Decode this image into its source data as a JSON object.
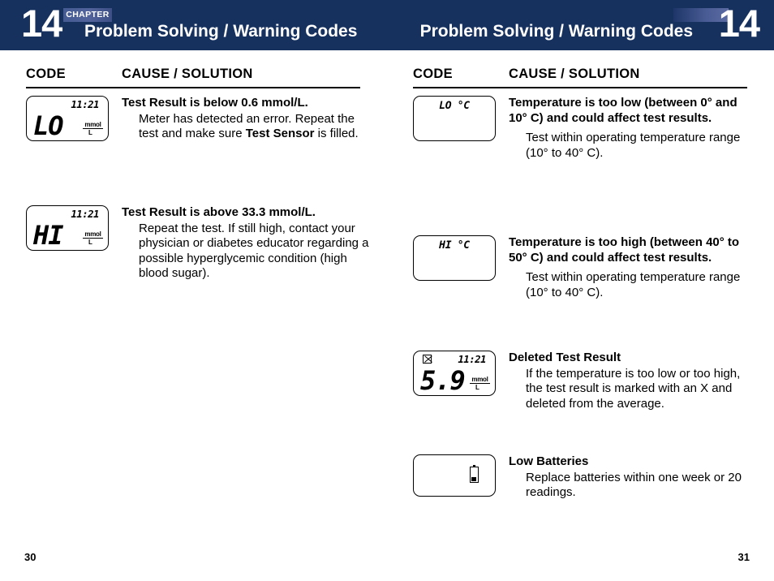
{
  "header": {
    "chapter_badge": "CHAPTER",
    "chapter_number_left": "14",
    "chapter_number_right": "14",
    "title_left": "Problem Solving / Warning Codes",
    "title_right": "Problem Solving / Warning Codes",
    "bar_color": "#17315f",
    "badge_color": "#52639c"
  },
  "columns": {
    "code_header": "CODE",
    "cause_header": "CAUSE / SOLUTION"
  },
  "left_page": {
    "folio": "30",
    "entries": [
      {
        "lcd": {
          "time": "11:21",
          "value": "LO",
          "unit_numerator": "mmol",
          "unit_denominator": "L"
        },
        "title": "Test Result is below 0.6 mmol/L.",
        "body_plain_1": "Meter has detected an error. Repeat the test and make sure ",
        "body_bold": "Test Sensor",
        "body_plain_2": " is filled."
      },
      {
        "lcd": {
          "time": "11:21",
          "value": "HI",
          "unit_numerator": "mmol",
          "unit_denominator": "L"
        },
        "title": "Test Result is above 33.3 mmol/L.",
        "body": "Repeat the test. If still high, contact your physician or diabetes educator regarding a possible hyperglycemic condition (high blood sugar)."
      }
    ]
  },
  "right_page": {
    "folio": "31",
    "entries": [
      {
        "lcd": {
          "code": "LO °C"
        },
        "title": "Temperature is too low (between 0° and 10° C) and could affect test results.",
        "body": "Test within operating temperature range (10° to 40° C)."
      },
      {
        "lcd": {
          "code": "HI °C"
        },
        "title": "Temperature is too high (between 40° to 50° C) and could affect test results.",
        "body": "Test within operating temperature range (10° to 40° C)."
      },
      {
        "lcd": {
          "marker": "x-in-box",
          "time": "11:21",
          "value": "5.9",
          "unit_numerator": "mmol",
          "unit_denominator": "L"
        },
        "title": "Deleted Test Result",
        "body": "If the temperature is too low or too high, the test result is marked with an X and deleted from the average."
      },
      {
        "lcd": {
          "icon": "battery-icon"
        },
        "title": "Low Batteries",
        "body": "Replace batteries within one week or 20 readings."
      }
    ]
  }
}
